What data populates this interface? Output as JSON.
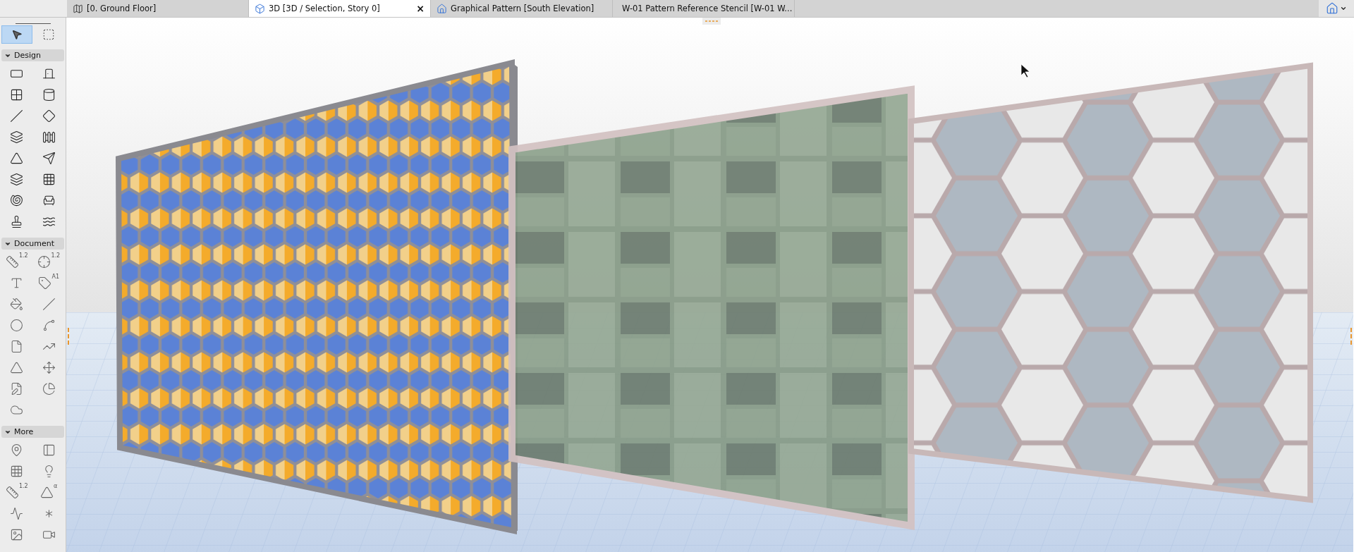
{
  "tabs": [
    {
      "label": "[0. Ground Floor]",
      "selected": false
    },
    {
      "label": "3D [3D / Selection, Story 0]",
      "selected": true,
      "close": "×"
    },
    {
      "label": "Graphical Pattern [South Elevation]",
      "selected": false
    },
    {
      "label": "W-01 Pattern Reference Stencil [W-01 W...",
      "selected": false
    }
  ],
  "toolbox": {
    "pointer_tools": [
      {
        "selected": true
      },
      {
        "selected": false
      }
    ],
    "sections": [
      {
        "title": "Design",
        "expanded": true
      },
      {
        "title": "Document",
        "expanded": true,
        "labels": [
          "1.2",
          "1.2",
          "A1"
        ]
      },
      {
        "title": "More",
        "expanded": true,
        "labels": [
          "1.2",
          "α"
        ]
      }
    ]
  }
}
